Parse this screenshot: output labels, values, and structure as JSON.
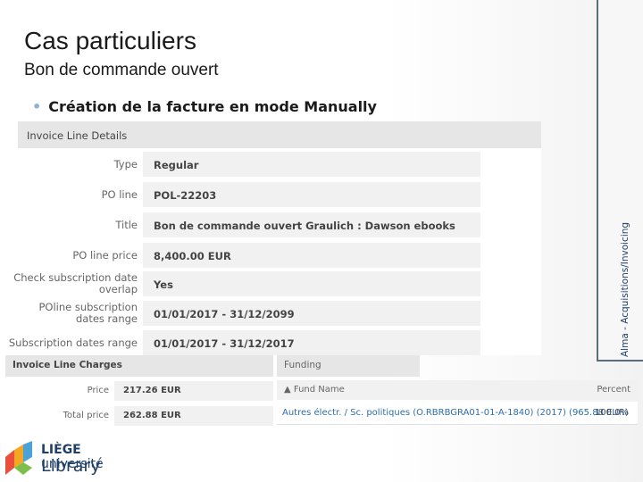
{
  "slide": {
    "title": "Cas particuliers",
    "subtitle": "Bon de commande ouvert",
    "bullet": "Création de la facture en mode Manually",
    "side_label": "Alma - Acquisitions/Invoicing"
  },
  "invoice_line_details": {
    "header": "Invoice Line Details",
    "rows": [
      {
        "label": "Type",
        "value": "Regular"
      },
      {
        "label": "PO line",
        "value": "POL-22203"
      },
      {
        "label": "Title",
        "value": "Bon de commande ouvert Graulich : Dawson ebooks"
      },
      {
        "label": "PO line price",
        "value": "8,400.00 EUR"
      },
      {
        "label": "Check subscription date overlap",
        "value": "Yes"
      },
      {
        "label": "POline subscription dates range",
        "value": "01/01/2017 - 31/12/2099"
      },
      {
        "label": "Subscription dates range",
        "value": "01/01/2017 - 31/12/2017"
      }
    ]
  },
  "invoice_line_charges": {
    "header": "Invoice Line Charges",
    "rows": [
      {
        "label": "Price",
        "value": "217.26 EUR"
      },
      {
        "label": "Total price",
        "value": "262.88 EUR"
      }
    ]
  },
  "funding": {
    "header": "Funding",
    "col_fund_name": "▲ Fund Name",
    "col_percent": "Percent",
    "rows": [
      {
        "fund_name": "Autres électr. / Sc. politiques (O.RBRBGRA01-01-A-1840) (2017) (965.88 EUR)",
        "percent": "100.0%"
      }
    ]
  },
  "logo": {
    "line1_bold": "LIÈGE",
    "line1_rest": " université",
    "line2": "Library"
  },
  "colors": {
    "accent": "#1f3f66",
    "link": "#2d6fa8",
    "bullet": "#8fb3c9"
  }
}
